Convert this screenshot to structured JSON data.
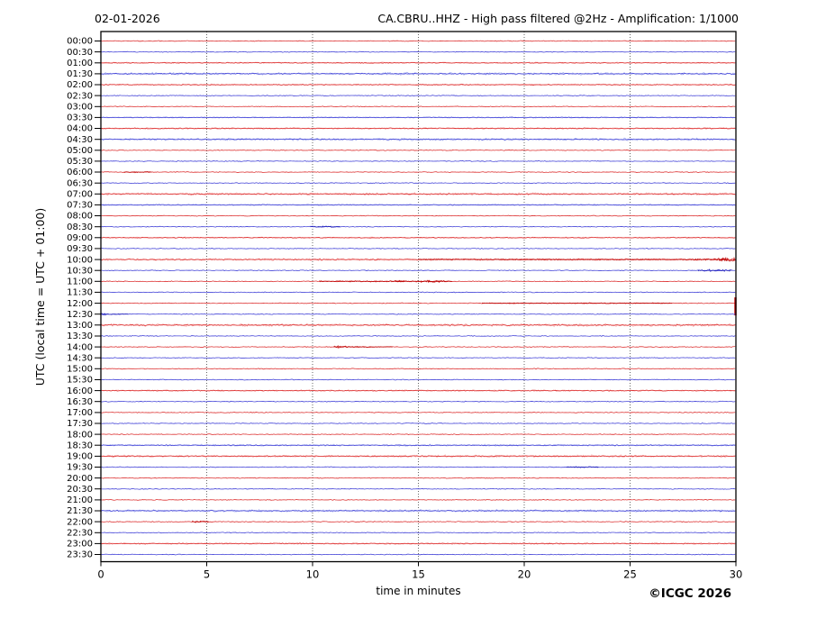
{
  "figure": {
    "date": "02-01-2026",
    "title": "CA.CBRU..HHZ - High pass filtered @2Hz - Amplification: 1/1000",
    "credit": "©ICGC 2026"
  },
  "chart_data": {
    "type": "line",
    "subtype": "helicorder-seismogram",
    "station": "CA.CBRU..HHZ",
    "filter": "High pass filtered @2Hz",
    "amplification": "1/1000",
    "date": "02-01-2026",
    "xlabel": "time in minutes",
    "ylabel": "UTC (local time = UTC + 01:00)",
    "x_range": [
      0,
      30
    ],
    "x_ticks": [
      0,
      5,
      10,
      15,
      20,
      25,
      30
    ],
    "grid_minutes": [
      5,
      10,
      15,
      20,
      25
    ],
    "minutes_per_row": 30,
    "legend": "none",
    "row_encoding": "t=UTC start time label, c=trace color (r=red hour rows, b=blue half-hour rows), a=background noise half-amplitude px, h=light halo band half-amplitude px (0=thin quiet trace), e=events [start_min,end_min,amp_px,shape], spike=[minute,up_px,down_px] clipped transient",
    "colors": {
      "red_core": "#dd3333",
      "red_halo": "#f6abab",
      "red_dark": "#bb0000",
      "blue_core": "#4545d8",
      "blue_halo": "#aab2f0",
      "blue_dark": "#1a1ab8",
      "grid": "#555555",
      "frame": "#000000",
      "text": "#000000",
      "background": "#ffffff"
    },
    "rows": [
      {
        "t": "00:00",
        "c": "r",
        "a": 0.5,
        "h": 0
      },
      {
        "t": "00:30",
        "c": "b",
        "a": 0.5,
        "h": 0
      },
      {
        "t": "01:00",
        "c": "r",
        "a": 0.55,
        "h": 0.8
      },
      {
        "t": "01:30",
        "c": "b",
        "a": 0.6,
        "h": 1.6
      },
      {
        "t": "02:00",
        "c": "r",
        "a": 0.55,
        "h": 0.9
      },
      {
        "t": "02:30",
        "c": "b",
        "a": 0.5,
        "h": 0
      },
      {
        "t": "03:00",
        "c": "r",
        "a": 0.5,
        "h": 0
      },
      {
        "t": "03:30",
        "c": "b",
        "a": 0.5,
        "h": 0.7
      },
      {
        "t": "04:00",
        "c": "r",
        "a": 0.55,
        "h": 1.0
      },
      {
        "t": "04:30",
        "c": "b",
        "a": 0.6,
        "h": 1.5
      },
      {
        "t": "05:00",
        "c": "r",
        "a": 0.5,
        "h": 0
      },
      {
        "t": "05:30",
        "c": "b",
        "a": 0.5,
        "h": 0
      },
      {
        "t": "06:00",
        "c": "r",
        "a": 0.5,
        "h": 0,
        "e": [
          [
            1.1,
            2.4,
            0.7,
            "flat"
          ]
        ]
      },
      {
        "t": "06:30",
        "c": "b",
        "a": 0.5,
        "h": 0
      },
      {
        "t": "07:00",
        "c": "r",
        "a": 0.6,
        "h": 1.5
      },
      {
        "t": "07:30",
        "c": "b",
        "a": 0.55,
        "h": 0.8
      },
      {
        "t": "08:00",
        "c": "r",
        "a": 0.5,
        "h": 0
      },
      {
        "t": "08:30",
        "c": "b",
        "a": 0.5,
        "h": 0,
        "e": [
          [
            9.9,
            11.3,
            0.8,
            "flat"
          ]
        ]
      },
      {
        "t": "09:00",
        "c": "r",
        "a": 0.55,
        "h": 0.7
      },
      {
        "t": "09:30",
        "c": "b",
        "a": 0.5,
        "h": 0
      },
      {
        "t": "10:00",
        "c": "r",
        "a": 0.65,
        "h": 1.3,
        "e": [
          [
            15,
            26.5,
            0.6,
            "flat"
          ],
          [
            26.5,
            29.4,
            1.8,
            "grow"
          ],
          [
            29.2,
            30,
            2.6,
            "flat"
          ]
        ]
      },
      {
        "t": "10:30",
        "c": "b",
        "a": 0.5,
        "h": 0,
        "e": [
          [
            28.2,
            29.8,
            1.2,
            "flat"
          ]
        ]
      },
      {
        "t": "11:00",
        "c": "r",
        "a": 0.5,
        "h": 0,
        "e": [
          [
            10.3,
            16.6,
            0.8,
            "flat"
          ],
          [
            13.9,
            14.4,
            1.5,
            "flat"
          ],
          [
            15.1,
            16.3,
            1.2,
            "flat"
          ]
        ]
      },
      {
        "t": "11:30",
        "c": "b",
        "a": 0.5,
        "h": 0
      },
      {
        "t": "12:00",
        "c": "r",
        "a": 0.5,
        "h": 0,
        "e": [
          [
            18,
            27,
            0.55,
            "flat"
          ]
        ],
        "spike": [
          30,
          6.5,
          13.5
        ]
      },
      {
        "t": "12:30",
        "c": "b",
        "a": 0.5,
        "h": 0,
        "e": [
          [
            0,
            0.4,
            2.8,
            "decay"
          ],
          [
            0.4,
            1.3,
            0.8,
            "decay"
          ]
        ]
      },
      {
        "t": "13:00",
        "c": "r",
        "a": 0.65,
        "h": 1.6
      },
      {
        "t": "13:30",
        "c": "b",
        "a": 0.5,
        "h": 0
      },
      {
        "t": "14:00",
        "c": "r",
        "a": 0.5,
        "h": 0,
        "e": [
          [
            11.0,
            11.7,
            2.2,
            "flat"
          ],
          [
            11.7,
            13.8,
            0.9,
            "decay"
          ]
        ]
      },
      {
        "t": "14:30",
        "c": "b",
        "a": 0.5,
        "h": 0
      },
      {
        "t": "15:00",
        "c": "r",
        "a": 0.5,
        "h": 0
      },
      {
        "t": "15:30",
        "c": "b",
        "a": 0.5,
        "h": 0
      },
      {
        "t": "16:00",
        "c": "r",
        "a": 0.55,
        "h": 0.9
      },
      {
        "t": "16:30",
        "c": "b",
        "a": 0.5,
        "h": 0
      },
      {
        "t": "17:00",
        "c": "r",
        "a": 0.5,
        "h": 0
      },
      {
        "t": "17:30",
        "c": "b",
        "a": 0.5,
        "h": 0
      },
      {
        "t": "18:00",
        "c": "r",
        "a": 0.5,
        "h": 0
      },
      {
        "t": "18:30",
        "c": "b",
        "a": 0.55,
        "h": 1.1
      },
      {
        "t": "19:00",
        "c": "r",
        "a": 0.6,
        "h": 1.4
      },
      {
        "t": "19:30",
        "c": "b",
        "a": 0.5,
        "h": 0,
        "e": [
          [
            22,
            23.5,
            0.7,
            "flat"
          ]
        ]
      },
      {
        "t": "20:00",
        "c": "r",
        "a": 0.5,
        "h": 0
      },
      {
        "t": "20:30",
        "c": "b",
        "a": 0.5,
        "h": 0
      },
      {
        "t": "21:00",
        "c": "r",
        "a": 0.5,
        "h": 0
      },
      {
        "t": "21:30",
        "c": "b",
        "a": 0.6,
        "h": 1.5
      },
      {
        "t": "22:00",
        "c": "r",
        "a": 0.5,
        "h": 0,
        "e": [
          [
            4.3,
            5.1,
            1.1,
            "flat"
          ]
        ]
      },
      {
        "t": "22:30",
        "c": "b",
        "a": 0.5,
        "h": 0
      },
      {
        "t": "23:00",
        "c": "r",
        "a": 0.55,
        "h": 1.0
      },
      {
        "t": "23:30",
        "c": "b",
        "a": 0.5,
        "h": 0
      }
    ]
  }
}
